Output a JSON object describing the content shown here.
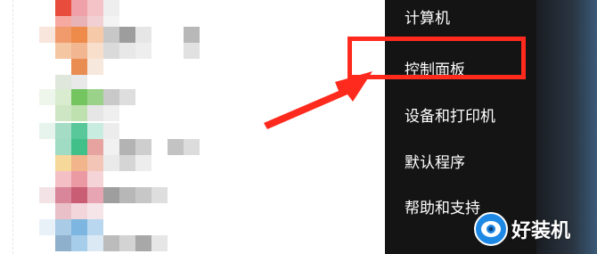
{
  "start_menu": {
    "right_items": [
      {
        "label": "计算机"
      },
      {
        "label": "控制面板"
      },
      {
        "label": "设备和打印机"
      },
      {
        "label": "默认程序"
      },
      {
        "label": "帮助和支持"
      }
    ],
    "highlighted_item": "控制面板"
  },
  "annotation": {
    "highlight_color": "#ff2a1e",
    "arrow_color": "#ff2a1e"
  },
  "watermark": {
    "text": "好装机",
    "icon": "camera-logo-icon"
  },
  "colors": {
    "panel_bg": "#141414",
    "menu_text": "#ffffff"
  }
}
